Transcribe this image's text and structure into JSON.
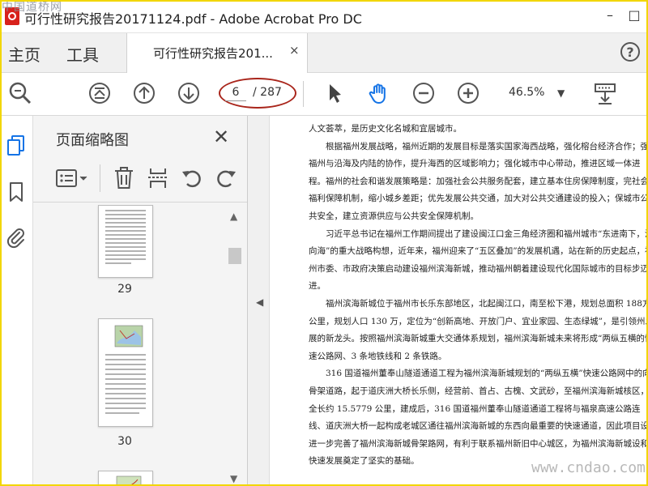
{
  "window": {
    "title": "可行性研究报告20171124.pdf - Adobe Acrobat Pro DC",
    "watermark_top": "中国道桥网",
    "minimize": "–",
    "maximize": "□"
  },
  "menubar": {
    "home": "主页",
    "tools": "工具",
    "tab_label": "可行性研究报告201...",
    "tab_close": "×",
    "help": "?"
  },
  "toolbar": {
    "current_page": "6",
    "total_pages": "/ 287",
    "zoom": "46.5%"
  },
  "panel": {
    "title": "页面缩略图",
    "close": "✕",
    "thumbnails": [
      {
        "label": "29"
      },
      {
        "label": "30"
      }
    ]
  },
  "document": {
    "paragraphs": [
      "人文荟萃，是历史文化名城和宜居城市。",
      "根据福州发展战略，福州近期的发展目标是落实国家海西战略，强化榕台经济合作；强福州与沿海及内陆的协作，提升海西的区域影响力；强化城市中心带动，推进区域一体进程。福州的社会和谐发展策略是：加强社会公共服务配套，建立基本住房保障制度，完社会福利保障机制，缩小城乡差距；优先发展公共交通，加大对公共交通建设的投入；保城市公共安全，建立资源供应与公共安全保障机制。",
      "习近平总书记在福州工作期间提出了建设闽江口金三角经济圈和福州城市“东进南下，江向海”的重大战略构想，近年来，福州迎来了“五区叠加”的发展机遇，站在新的历史起点，福州市委、市政府决策启动建设福州滨海新城，推动福州朝着建设现代化国际城市的目标步迈进。",
      "福州滨海新城位于福州市长乐东部地区，北起闽江口，南至松下港，规划总面积 188方公里，规划人口 130 万，定位为“创新高地、开放门户、宜业家园、生态绿城”，是引领州发展的新龙头。按照福州滨海新城重大交通体系规划，福州滨海新城未来将形成“两纵五横的快速公路网、3 条地铁线和 2 条铁路。",
      "316 国道福州董奉山隧道通道工程为福州滨海新城规划的“两纵五横”快速公路网中的向骨架道路，起于道庆洲大桥长乐侧，经营前、首占、古槐、文武砂，至福州滨海新城核区，全长约 15.5779 公里，建成后，316 国道福州董奉山隧道通道工程将与福泉高速公路连线、道庆洲大桥一起构成老城区通往福州滨海新城的东西向最重要的快速通道，因此项目设进一步完善了福州滨海新城骨架路网，有利于联系福州新旧中心城区，为福州滨海新城设和快速发展奠定了坚实的基础。"
    ],
    "watermark_bottom": "www.cndao.com"
  },
  "colors": {
    "frame": "#f2d600",
    "oval": "#a9251b",
    "acrobat_red": "#d8221c",
    "hand_tool": "#1473e6"
  }
}
